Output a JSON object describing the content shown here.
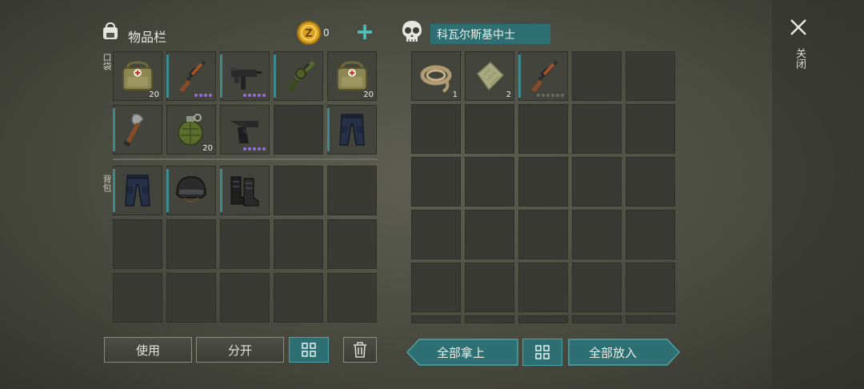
{
  "inventory": {
    "title": "物品栏",
    "coins": "0",
    "pocket_label": "口袋",
    "backpack_label": "背包",
    "pocket_slots": [
      {
        "icon": "medkit-bag-icon",
        "qty": "20",
        "accent": false,
        "dots": 0
      },
      {
        "icon": "shotgun-icon",
        "qty": "",
        "accent": true,
        "dots": 4
      },
      {
        "icon": "uzi-icon",
        "qty": "",
        "accent": true,
        "dots": 5
      },
      {
        "icon": "grenade-launcher-icon",
        "qty": "",
        "accent": true,
        "dots": 0
      },
      {
        "icon": "medkit-bag-icon",
        "qty": "20",
        "accent": false,
        "dots": 0
      },
      {
        "icon": "shovel-icon",
        "qty": "",
        "accent": true,
        "dots": 0
      },
      {
        "icon": "frag-grenade-icon",
        "qty": "20",
        "accent": false,
        "dots": 0
      },
      {
        "icon": "pistol-icon",
        "qty": "",
        "accent": false,
        "dots": 5
      },
      {
        "icon": "",
        "qty": "",
        "accent": false,
        "dots": 0
      },
      {
        "icon": "pants-icon",
        "qty": "",
        "accent": true,
        "dots": 0
      }
    ],
    "backpack_slots": [
      {
        "icon": "pants-icon",
        "qty": "",
        "accent": true
      },
      {
        "icon": "helmet-icon",
        "qty": "",
        "accent": true
      },
      {
        "icon": "boots-icon",
        "qty": "",
        "accent": true
      }
    ],
    "buttons": {
      "use": "使用",
      "split": "分开"
    }
  },
  "container": {
    "owner_name": "科瓦尔斯基中士",
    "slots": [
      {
        "icon": "rope-icon",
        "qty": "1"
      },
      {
        "icon": "cloth-icon",
        "qty": "2"
      },
      {
        "icon": "shotgun-icon",
        "qty": "",
        "accent": true,
        "grey_dots": 6
      }
    ],
    "buttons": {
      "take_all": "全部拿上",
      "put_all": "全部放入"
    }
  },
  "close_label": "关闭",
  "colors": {
    "accent_teal": "#3d8a8e",
    "button_teal": "#2d6f72",
    "rare_purple": "#8f72d8",
    "coin_gold": "#d9a11f"
  }
}
